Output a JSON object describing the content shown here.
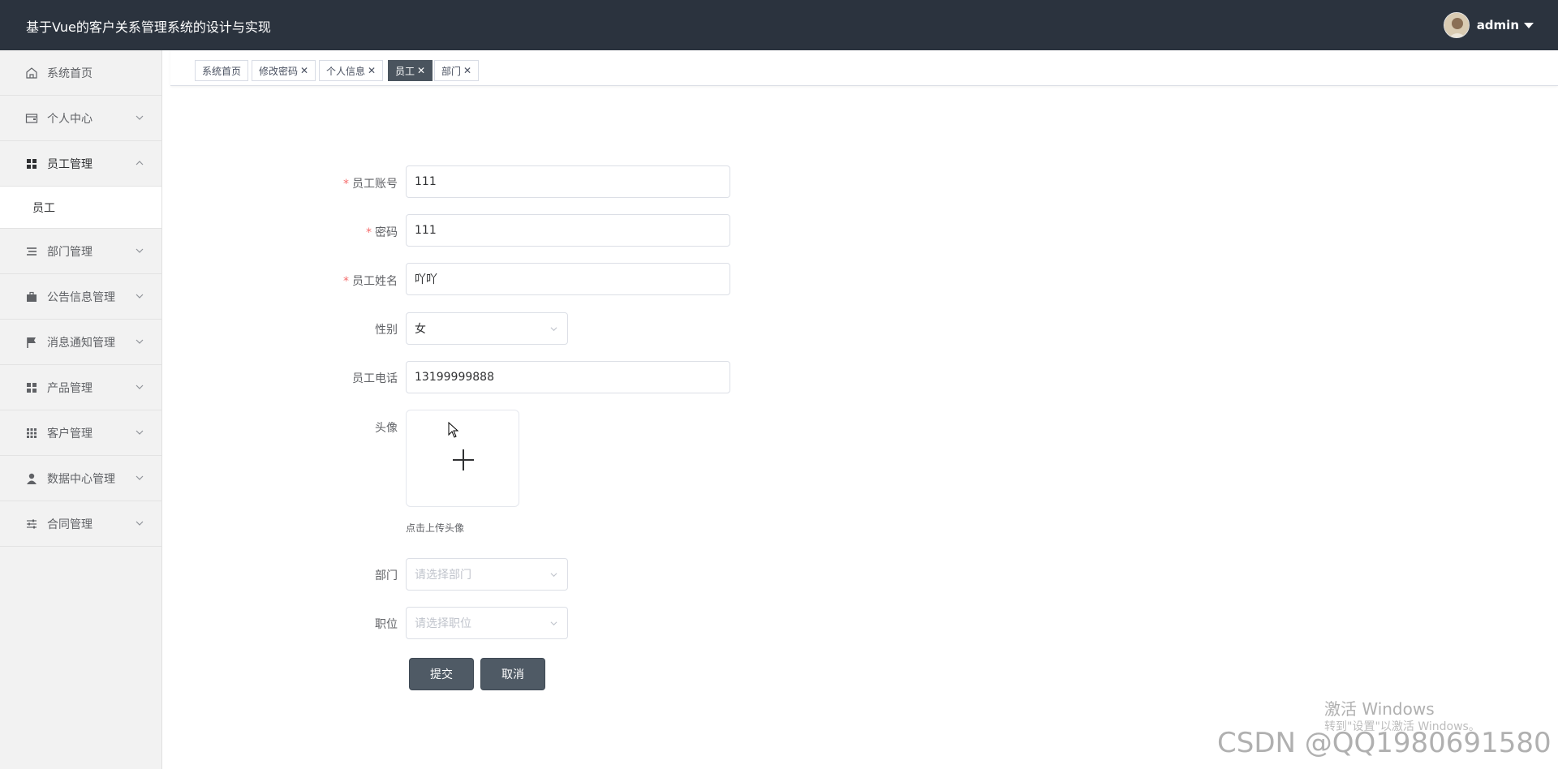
{
  "header": {
    "title": "基于Vue的客户关系管理系统的设计与实现",
    "username": "admin"
  },
  "sidebar": {
    "items": [
      {
        "label": "系统首页",
        "icon": "home-icon"
      },
      {
        "label": "个人中心",
        "icon": "wallet-icon"
      },
      {
        "label": "员工管理",
        "icon": "grid-icon",
        "open": true,
        "children": [
          {
            "label": "员工"
          }
        ]
      },
      {
        "label": "部门管理",
        "icon": "list-icon"
      },
      {
        "label": "公告信息管理",
        "icon": "briefcase-icon"
      },
      {
        "label": "消息通知管理",
        "icon": "flag-icon"
      },
      {
        "label": "产品管理",
        "icon": "grid-icon"
      },
      {
        "label": "客户管理",
        "icon": "apps-icon"
      },
      {
        "label": "数据中心管理",
        "icon": "user-icon"
      },
      {
        "label": "合同管理",
        "icon": "sliders-icon"
      }
    ]
  },
  "tabs": [
    {
      "label": "系统首页",
      "closable": false,
      "active": false
    },
    {
      "label": "修改密码",
      "closable": true,
      "active": false
    },
    {
      "label": "个人信息",
      "closable": true,
      "active": false
    },
    {
      "label": "员工",
      "closable": true,
      "active": true
    },
    {
      "label": "部门",
      "closable": true,
      "active": false
    }
  ],
  "form": {
    "account": {
      "label": "员工账号",
      "value": "111",
      "required": true
    },
    "password": {
      "label": "密码",
      "value": "111",
      "required": true
    },
    "name": {
      "label": "员工姓名",
      "value": "吖吖",
      "required": true
    },
    "gender": {
      "label": "性别",
      "value": "女"
    },
    "phone": {
      "label": "员工电话",
      "value": "13199999888"
    },
    "avatar": {
      "label": "头像",
      "tip": "点击上传头像"
    },
    "department": {
      "label": "部门",
      "placeholder": "请选择部门"
    },
    "position": {
      "label": "职位",
      "placeholder": "请选择职位"
    },
    "submit_label": "提交",
    "cancel_label": "取消",
    "required_mark": "*"
  },
  "watermarks": {
    "activate_title": "激活 Windows",
    "activate_sub": "转到\"设置\"以激活 Windows。",
    "csdn": "CSDN @QQ1980691580"
  },
  "colors": {
    "header_bg": "#2b333e",
    "active_tab": "#4a545e",
    "button": "#4f5a65",
    "required": "#f56c6c"
  }
}
